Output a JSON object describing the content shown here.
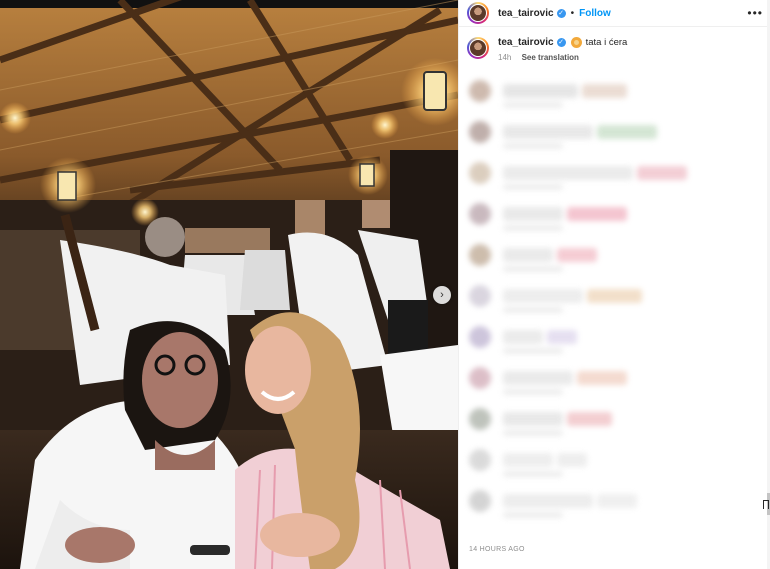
{
  "post": {
    "username": "tea_tairovic",
    "follow_label": "Follow",
    "separator": "•",
    "more_label": "•••",
    "caption_text": "tata i ćera",
    "caption_emoji": "lion-face-emoji",
    "caption_age": "14h",
    "see_translation": "See translation",
    "timestamp": "14 HOURS AGO"
  },
  "photo": {
    "description_icon": "photo",
    "next_arrow": "›"
  },
  "colors": {
    "accent": "#0095f6",
    "verified": "#3897f0",
    "muted": "#8e8e8e"
  },
  "comments": [
    {
      "avatar": "#c9b3a6",
      "bar": "#e3e3e3",
      "accent": "#e9d9cf"
    },
    {
      "avatar": "#b9a7a2",
      "bar": "#e6e6e6",
      "accent": "#cfe3cf"
    },
    {
      "avatar": "#d8c9b8",
      "bar": "#e9e9e9",
      "accent": "#f2c9d1"
    },
    {
      "avatar": "#c4b2b8",
      "bar": "#e7e7e7",
      "accent": "#f3bfcb"
    },
    {
      "avatar": "#c8b6a4",
      "bar": "#e8e8e8",
      "accent": "#f4c7cf"
    },
    {
      "avatar": "#d6d1dc",
      "bar": "#ebebeb",
      "accent": "#f1dcc4"
    },
    {
      "avatar": "#c8bfd8",
      "bar": "#e9e9e9",
      "accent": "#e3dcef"
    },
    {
      "avatar": "#d9b8c2",
      "bar": "#e8e8e8",
      "accent": "#f3d7cb"
    },
    {
      "avatar": "#b8bdb5",
      "bar": "#e6e6e6",
      "accent": "#f2c9cc"
    },
    {
      "avatar": "#d7d7d7",
      "bar": "#ececec",
      "accent": "#ececec"
    },
    {
      "avatar": "#d0d0d0",
      "bar": "#ebebeb",
      "accent": "#eeeeee"
    }
  ]
}
